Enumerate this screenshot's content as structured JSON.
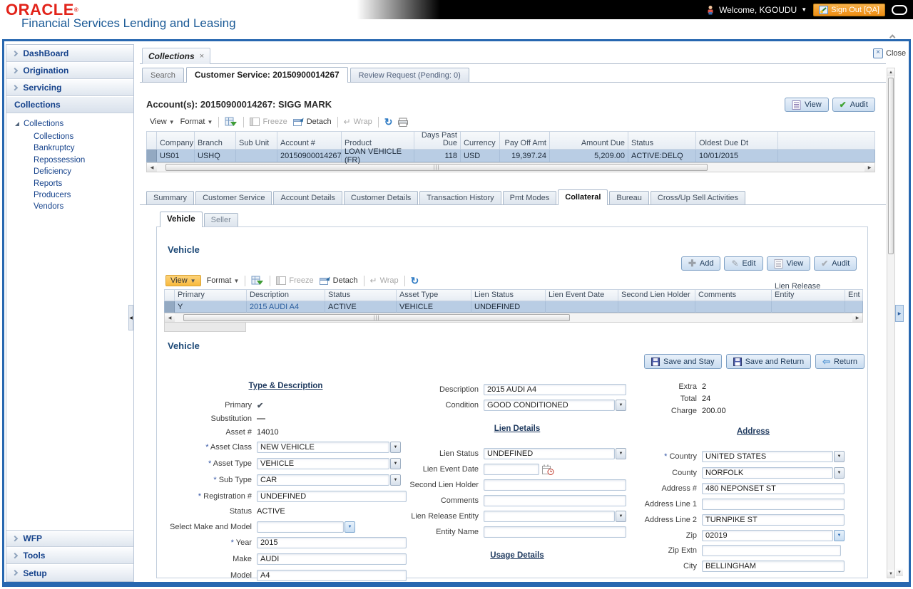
{
  "branding": {
    "logo": "ORACLE",
    "registered": "®",
    "subtitle": "Financial Services Lending and Leasing"
  },
  "topbar": {
    "welcome": "Welcome, KGOUDU",
    "signout": "Sign Out [QA]"
  },
  "sidebar": {
    "top_sections": [
      "DashBoard",
      "Origination",
      "Servicing"
    ],
    "active_section": "Collections",
    "tree_root": "Collections",
    "tree_items": [
      "Collections",
      "Bankruptcy",
      "Repossession",
      "Deficiency",
      "Reports",
      "Producers",
      "Vendors"
    ],
    "bottom_sections": [
      "WFP",
      "Tools",
      "Setup"
    ]
  },
  "tabs": {
    "document_tab": "Collections",
    "close_label": "Close",
    "search": "Search",
    "customer_service": "Customer Service: 20150900014267",
    "review_request": "Review Request (Pending: 0)"
  },
  "toolbar": {
    "view": "View",
    "format": "Format",
    "freeze": "Freeze",
    "detach": "Detach",
    "wrap": "Wrap"
  },
  "buttons": {
    "view": "View",
    "audit": "Audit",
    "add": "Add",
    "edit": "Edit",
    "save_stay": "Save and Stay",
    "save_return": "Save and Return",
    "return": "Return"
  },
  "account": {
    "title": "Account(s): 20150900014267: SIGG MARK",
    "columns": [
      "Company",
      "Branch",
      "Sub Unit",
      "Account #",
      "Product",
      "Days Past Due",
      "Currency",
      "Pay Off Amt",
      "Amount Due",
      "Status",
      "Oldest Due Dt"
    ],
    "row": {
      "company": "US01",
      "branch": "USHQ",
      "sub_unit": "",
      "account_no": "20150900014267",
      "product": "LOAN VEHICLE (FR)",
      "days_past_due": "118",
      "currency": "USD",
      "pay_off_amt": "19,397.24",
      "amount_due": "5,209.00",
      "status": "ACTIVE:DELQ",
      "oldest_due_dt": "10/01/2015"
    }
  },
  "subtabs": [
    "Summary",
    "Customer Service",
    "Account Details",
    "Customer Details",
    "Transaction History",
    "Pmt Modes",
    "Collateral",
    "Bureau",
    "Cross/Up Sell Activities"
  ],
  "collateral_tabs": [
    "Vehicle",
    "Seller"
  ],
  "vehicle_grid": {
    "heading": "Vehicle",
    "columns": [
      "Primary",
      "Description",
      "Status",
      "Asset Type",
      "Lien Status",
      "Lien Event Date",
      "Second Lien Holder",
      "Comments",
      "Lien Release Entity",
      "Ent"
    ],
    "row": {
      "primary": "Y",
      "description": "2015 AUDI A4",
      "status": "ACTIVE",
      "asset_type": "VEHICLE",
      "lien_status": "UNDEFINED",
      "lien_event_date": "",
      "second_lien_holder": "",
      "comments": "",
      "lien_release_entity": "",
      "ent": ""
    }
  },
  "form": {
    "heading": "Vehicle",
    "type_desc": {
      "heading": "Type & Description",
      "primary_label": "Primary",
      "substitution_label": "Substitution",
      "asset_no_label": "Asset #",
      "asset_no": "14010",
      "asset_class_label": "Asset Class",
      "asset_class": "NEW VEHICLE",
      "asset_type_label": "Asset Type",
      "asset_type": "VEHICLE",
      "sub_type_label": "Sub Type",
      "sub_type": "CAR",
      "registration_label": "Registration #",
      "registration": "UNDEFINED",
      "status_label": "Status",
      "status": "ACTIVE",
      "make_model_label": "Select Make and Model",
      "make_model": "",
      "year_label": "Year",
      "year": "2015",
      "make_label": "Make",
      "make": "AUDI",
      "model_label": "Model",
      "model": "A4"
    },
    "desc": {
      "description_label": "Description",
      "description": "2015 AUDI A4",
      "condition_label": "Condition",
      "condition": "GOOD CONDITIONED"
    },
    "lien": {
      "heading": "Lien Details",
      "lien_status_label": "Lien Status",
      "lien_status": "UNDEFINED",
      "lien_event_date_label": "Lien Event Date",
      "lien_event_date": "",
      "second_lien_holder_label": "Second Lien Holder",
      "second_lien_holder": "",
      "comments_label": "Comments",
      "comments": "",
      "lien_release_entity_label": "Lien Release Entity",
      "lien_release_entity": "",
      "entity_name_label": "Entity Name",
      "entity_name": ""
    },
    "usage": {
      "heading": "Usage Details"
    },
    "totals": {
      "extra_label": "Extra",
      "extra": "2",
      "total_label": "Total",
      "total": "24",
      "charge_label": "Charge",
      "charge": "200.00"
    },
    "address": {
      "heading": "Address",
      "country_label": "Country",
      "country": "UNITED STATES",
      "county_label": "County",
      "county": "NORFOLK",
      "address_no_label": "Address #",
      "address_no": "480 NEPONSET ST",
      "line1_label": "Address Line 1",
      "line1": "",
      "line2_label": "Address Line 2",
      "line2": "TURNPIKE ST",
      "zip_label": "Zip",
      "zip": "02019",
      "zip_extn_label": "Zip Extn",
      "zip_extn": "",
      "city_label": "City",
      "city": "BELLINGHAM"
    }
  },
  "colors": {
    "accent_blue": "#2767b0",
    "selected_row": "#b9cde4",
    "signout_orange": "#ee8d12",
    "view_highlight": "#f8b93e"
  }
}
